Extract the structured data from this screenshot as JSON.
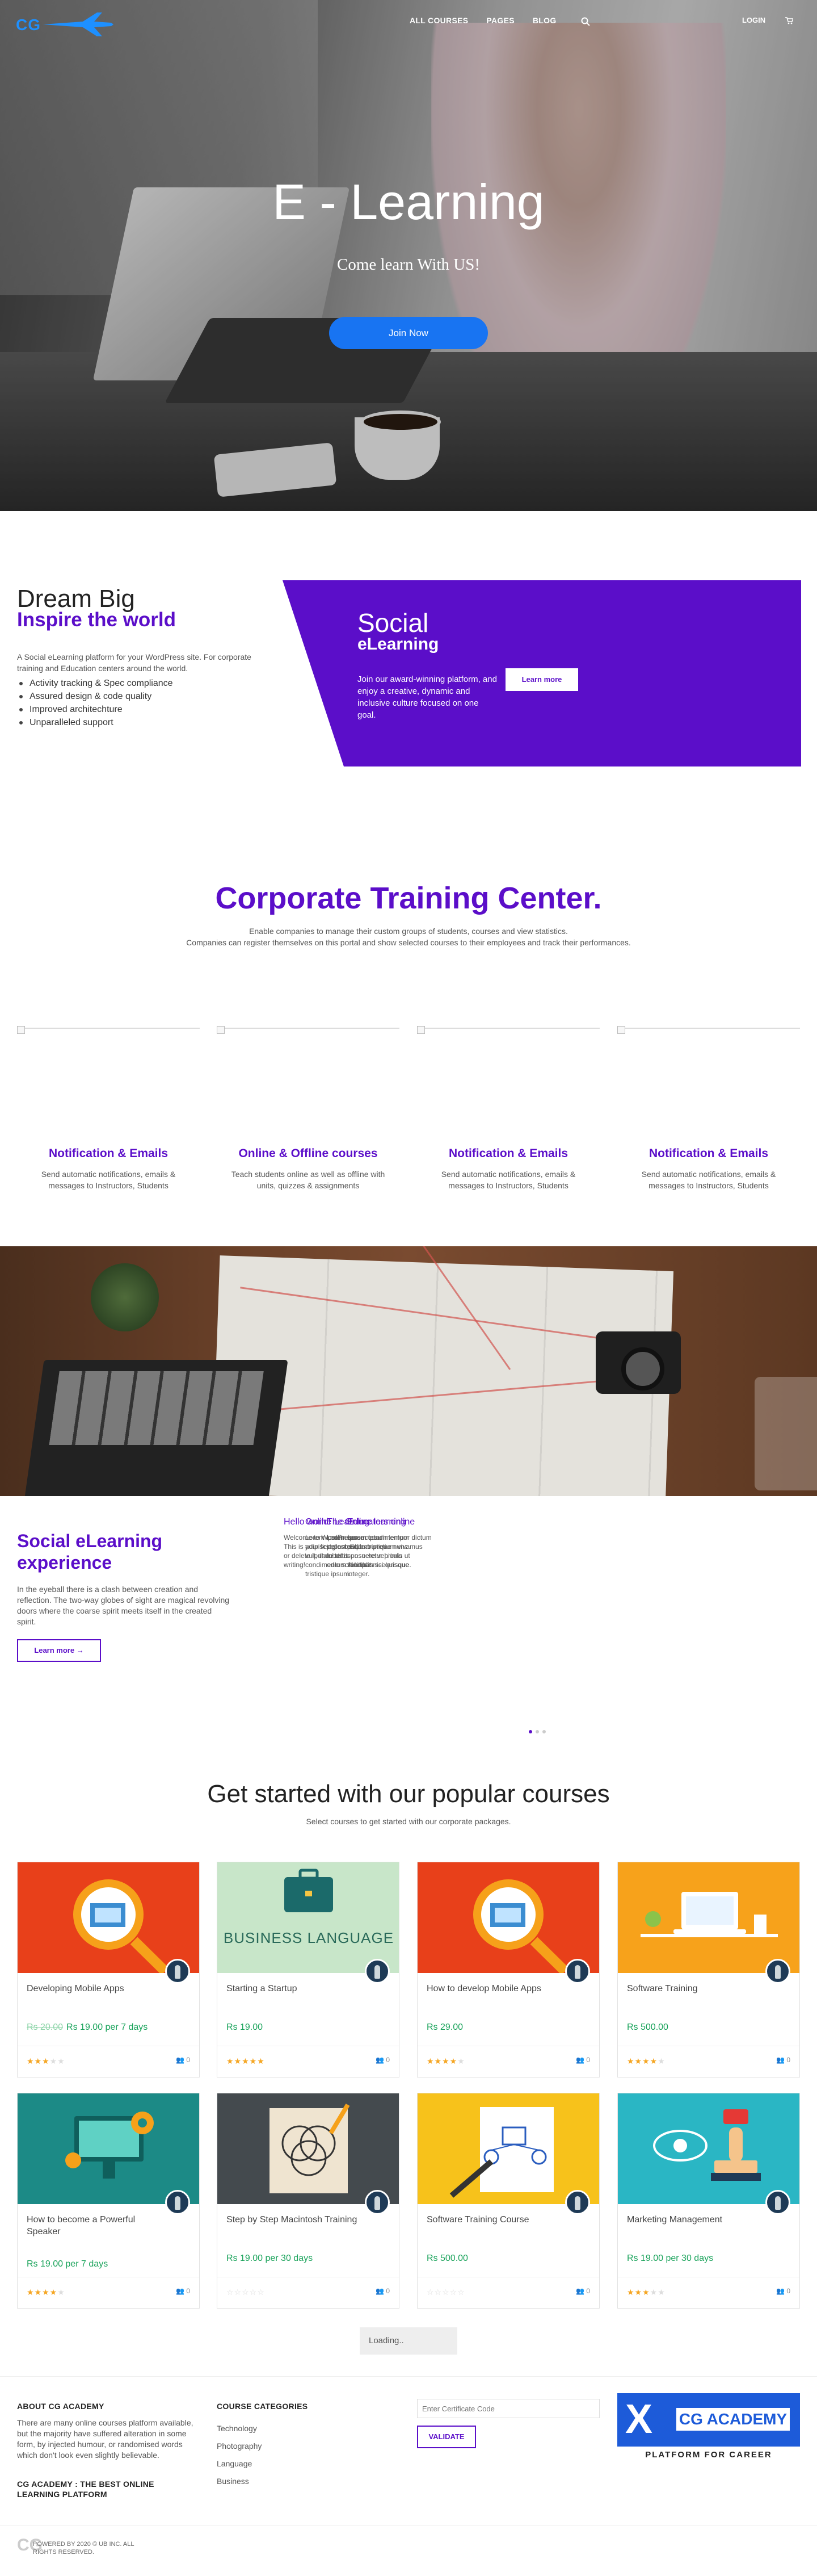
{
  "colors": {
    "brand_purple": "#5b0ec9",
    "primary_blue": "#1874f2",
    "logo_blue": "#1e90ff",
    "price_green": "#1aa35b",
    "star": "#f5a623"
  },
  "nav": {
    "logo_text": "CG",
    "items": [
      "ALL COURSES",
      "PAGES",
      "BLOG"
    ],
    "search_icon": "search-icon",
    "login": "LOGIN",
    "cart_icon": "cart-icon"
  },
  "hero": {
    "title": "E - Learning",
    "subtitle": "Come learn With US!",
    "button": "Join Now"
  },
  "dream": {
    "title": "Dream Big",
    "subtitle": "Inspire the world",
    "text": "A Social eLearning platform for your WordPress site. For corporate training and Education centers around the world.",
    "bullets": [
      "Activity tracking & Spec compliance",
      "Assured design & code quality",
      "Improved architechture",
      "Unparalleled support"
    ]
  },
  "social_card": {
    "title": "Social",
    "subtitle": "eLearning",
    "text": "Join our award-winning platform, and enjoy a creative, dynamic and inclusive culture focused on one goal.",
    "button": "Learn more"
  },
  "corporate": {
    "title": "Corporate Training Center.",
    "line1": "Enable companies to manage their custom groups of students, courses and view statistics.",
    "line2": "Companies can register themselves on this portal and show selected courses to their employees and track their performances."
  },
  "features": [
    {
      "title": "Notification & Emails",
      "text": "Send automatic notifications, emails & messages to Instructors, Students"
    },
    {
      "title": "Online & Offline courses",
      "text": "Teach students online as well as offline with units, quizzes & assignments"
    },
    {
      "title": "Notification & Emails",
      "text": "Send automatic notifications, emails & messages to Instructors, Students"
    },
    {
      "title": "Notification & Emails",
      "text": "Send automatic notifications, emails & messages to Instructors, Students"
    }
  ],
  "experience": {
    "title": "Social eLearning experience",
    "text": "In the eyeball there is a clash between creation and reflection. The two-way globes of sight are magical revolving doors where the coarse spirit meets itself in the created spirit.",
    "button": "Learn more →"
  },
  "slides": [
    {
      "title": "Hello world",
      "text": "Welcome to WordPress. This is your first post. Edit or delete it, then start writing!"
    },
    {
      "title": "Online Learning",
      "text": "Lorem ipsum consectetur adipiscing nunc numbur vulputate tellus condimentum faucibus tristique ipsum."
    },
    {
      "title": "The Online learning",
      "text": "Lorem ipsum condimentum pellentesque tristique nunc lobortis posuere vehicula odio sollicitudin scelerisque."
    },
    {
      "title": "Educators online",
      "text": "Lorem ipsum tempor dictum pulvinar pretium vivamus consectetur primis ut volutpat nisi quisque integer."
    }
  ],
  "courses": {
    "title": "Get started with our popular courses",
    "subtitle": "Select courses to get started with our corporate packages.",
    "items": [
      {
        "title": "Developing Mobile Apps",
        "old_price": "Rs 20.00",
        "price": "Rs 19.00  per 7 days",
        "rating": 3,
        "count": "0",
        "thumb": "mobile-magnifier"
      },
      {
        "title": "Starting a Startup",
        "old_price": "",
        "price": "Rs 19.00",
        "rating": 5,
        "count": "0",
        "thumb": "business-language",
        "thumb_text": "BUSINESS LANGUAGE"
      },
      {
        "title": "How to develop Mobile Apps",
        "old_price": "",
        "price": "Rs 29.00",
        "rating": 4,
        "count": "0",
        "thumb": "mobile-magnifier"
      },
      {
        "title": "Software Training",
        "old_price": "",
        "price": "Rs 500.00",
        "rating": 4,
        "count": "0",
        "thumb": "laptop-desk"
      },
      {
        "title": "How to become a Powerful Speaker",
        "old_price": "",
        "price": "Rs 19.00  per 7 days",
        "rating": 4,
        "count": "0",
        "thumb": "teal-gears"
      },
      {
        "title": "Step by Step Macintosh Training",
        "old_price": "",
        "price": "Rs 19.00  per 30 days",
        "rating": 0,
        "count": "0",
        "thumb": "venn-easel"
      },
      {
        "title": "Software Training Course",
        "old_price": "",
        "price": "Rs 500.00",
        "rating": 0,
        "count": "0",
        "thumb": "flowchart-pen"
      },
      {
        "title": "Marketing Management",
        "old_price": "",
        "price": "Rs 19.00  per 30 days",
        "rating": 3,
        "count": "0",
        "thumb": "stamp-eye"
      }
    ],
    "loading": "Loading.."
  },
  "footer": {
    "about_title": "ABOUT CG ACADEMY",
    "about_text": "There are many online courses platform available, but the majority have suffered alteration in some form, by injected humour, or randomised words which don't look even slightly believable.",
    "tagline": "CG ACADEMY : THE BEST ONLINE LEARNING PLATFORM",
    "categories_title": "COURSE CATEGORIES",
    "categories": [
      "Technology",
      "Photography",
      "Language",
      "Business"
    ],
    "certificate_placeholder": "Enter Certificate Code",
    "validate": "VALIDATE",
    "brand_x": "X",
    "brand_name": "CG ACADEMY",
    "brand_tag": "PLATFORM FOR CAREER",
    "copyright": "POWERED BY 2020 © UB INC. ALL RIGHTS RESERVED.",
    "footer_logo": "CG"
  }
}
